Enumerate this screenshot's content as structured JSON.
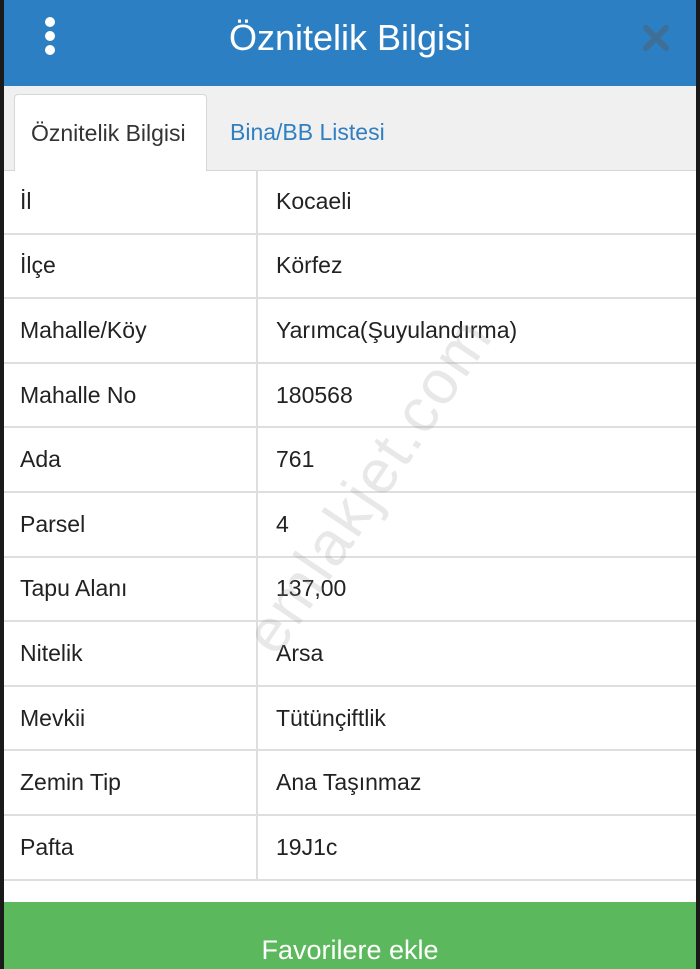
{
  "header": {
    "title": "Öznitelik Bilgisi",
    "menu_icon": "vertical-ellipsis-icon",
    "close_icon": "close-icon"
  },
  "tabs": [
    {
      "label": "Öznitelik Bilgisi",
      "active": true
    },
    {
      "label": "Bina/BB Listesi",
      "active": false
    }
  ],
  "attributes": [
    {
      "label": "İl",
      "value": "Kocaeli"
    },
    {
      "label": "İlçe",
      "value": "Körfez"
    },
    {
      "label": "Mahalle/Köy",
      "value": "Yarımca(Şuyulandırma)"
    },
    {
      "label": "Mahalle No",
      "value": "180568"
    },
    {
      "label": "Ada",
      "value": "761"
    },
    {
      "label": "Parsel",
      "value": "4"
    },
    {
      "label": "Tapu Alanı",
      "value": "137,00"
    },
    {
      "label": "Nitelik",
      "value": "Arsa"
    },
    {
      "label": "Mevkii",
      "value": "Tütünçiftlik"
    },
    {
      "label": "Zemin Tip",
      "value": "Ana Taşınmaz"
    },
    {
      "label": "Pafta",
      "value": "19J1c"
    }
  ],
  "footer": {
    "favorite_label": "Favorilere ekle"
  },
  "watermark": "emlakjet.com",
  "colors": {
    "header": "#2d7fc3",
    "tab_link": "#2f7fc1",
    "button": "#5cb85c"
  }
}
